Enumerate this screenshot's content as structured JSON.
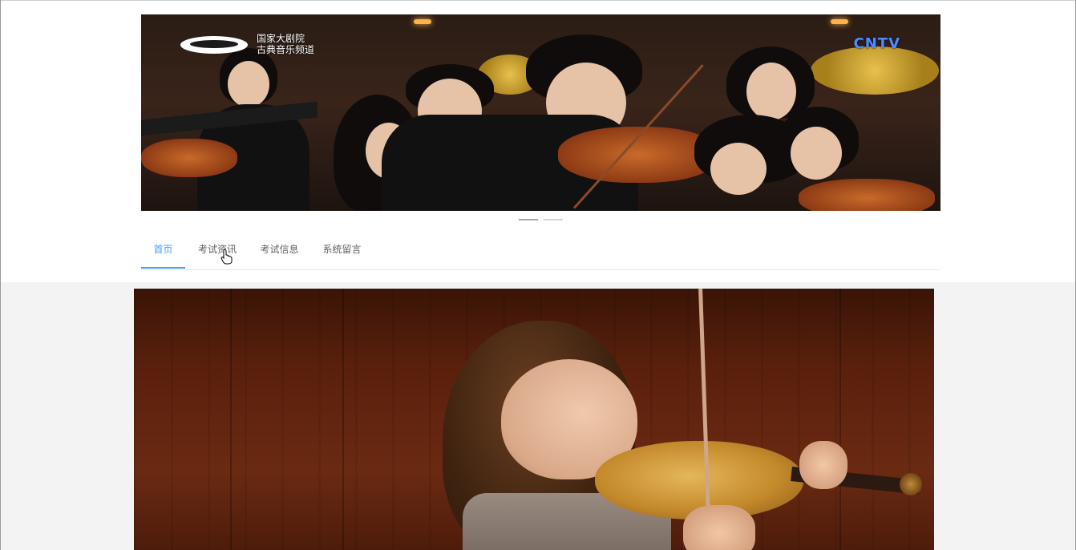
{
  "banner": {
    "logo_left_line1": "国家大剧院",
    "logo_left_line2": "古典音乐频道",
    "logo_right": "CNTV",
    "carousel_active_index": 1,
    "carousel_count": 2
  },
  "nav": {
    "items": [
      {
        "label": "首页",
        "active": true
      },
      {
        "label": "考试资讯",
        "active": false
      },
      {
        "label": "考试信息",
        "active": false
      },
      {
        "label": "系统留言",
        "active": false
      }
    ]
  },
  "colors": {
    "accent": "#409eff",
    "nav_text": "#606266",
    "lower_bg": "#f3f3f3"
  },
  "icons": {
    "cursor": "hand-pointer-icon"
  }
}
